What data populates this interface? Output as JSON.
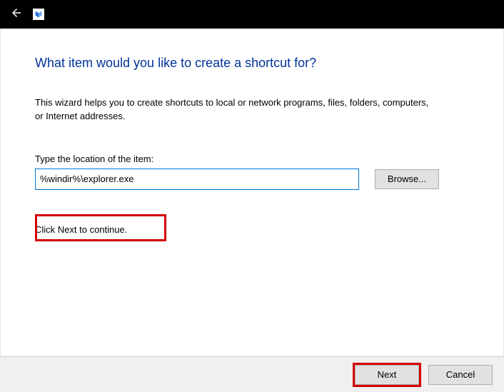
{
  "titlebar": {
    "title": ""
  },
  "heading": "What item would you like to create a shortcut for?",
  "description": "This wizard helps you to create shortcuts to local or network programs, files, folders, computers, or Internet addresses.",
  "location": {
    "label": "Type the location of the item:",
    "value": "%windir%\\explorer.exe",
    "browse_label": "Browse..."
  },
  "continue_text": "Click Next to continue.",
  "footer": {
    "next_label": "Next",
    "cancel_label": "Cancel"
  }
}
